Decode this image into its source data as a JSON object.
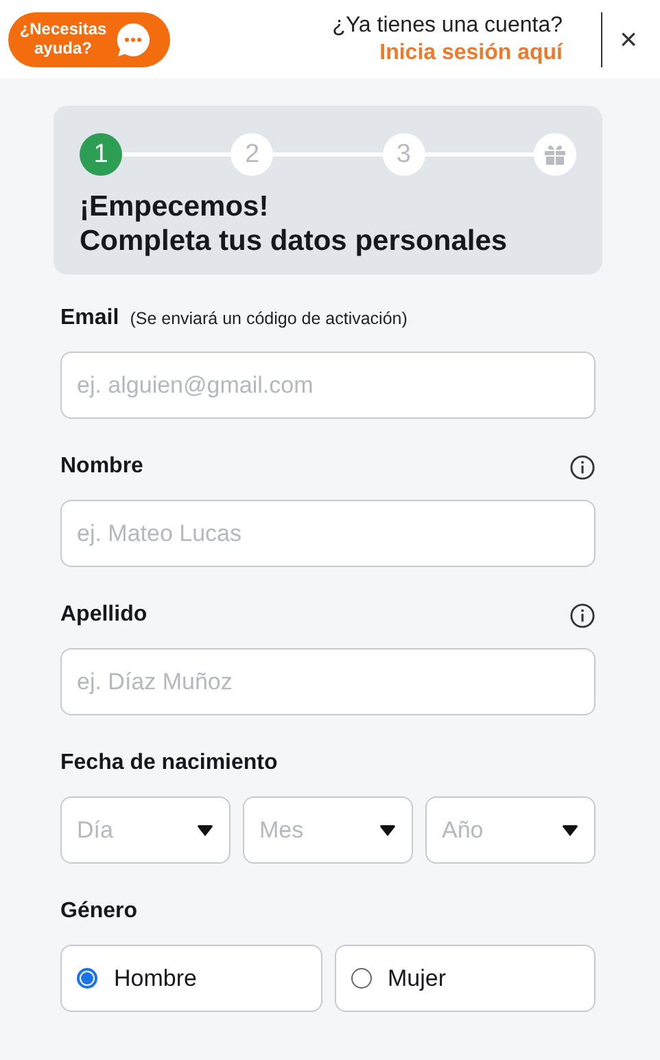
{
  "header": {
    "help_label": "¿Necesitas ayuda?",
    "account_question": "¿Ya tienes una cuenta?",
    "login_link": "Inicia sesión aquí",
    "close": "×"
  },
  "stepper": {
    "steps": [
      {
        "kind": "number",
        "label": "1",
        "selected": true
      },
      {
        "kind": "number",
        "label": "2",
        "selected": false
      },
      {
        "kind": "number",
        "label": "3",
        "selected": false
      },
      {
        "kind": "gift",
        "selected": false
      }
    ],
    "title": "¡Empecemos!",
    "subtitle": "Completa tus datos personales"
  },
  "fields": [
    {
      "label": "Email",
      "note": "(Se enviará un código de activación)",
      "placeholder": "ej. alguien@gmail.com",
      "info": false
    },
    {
      "label": "Nombre",
      "placeholder": "ej. Mateo Lucas",
      "info": true
    },
    {
      "label": "Apellido",
      "placeholder": "ej. Díaz Muñoz",
      "info": true
    }
  ],
  "birthdate": {
    "label": "Fecha de nacimiento",
    "selects": [
      {
        "placeholder": "Día"
      },
      {
        "placeholder": "Mes"
      },
      {
        "placeholder": "Año"
      }
    ]
  },
  "gender": {
    "label": "Género",
    "options": [
      {
        "label": "Hombre",
        "selected": true
      },
      {
        "label": "Mujer",
        "selected": false
      }
    ]
  }
}
